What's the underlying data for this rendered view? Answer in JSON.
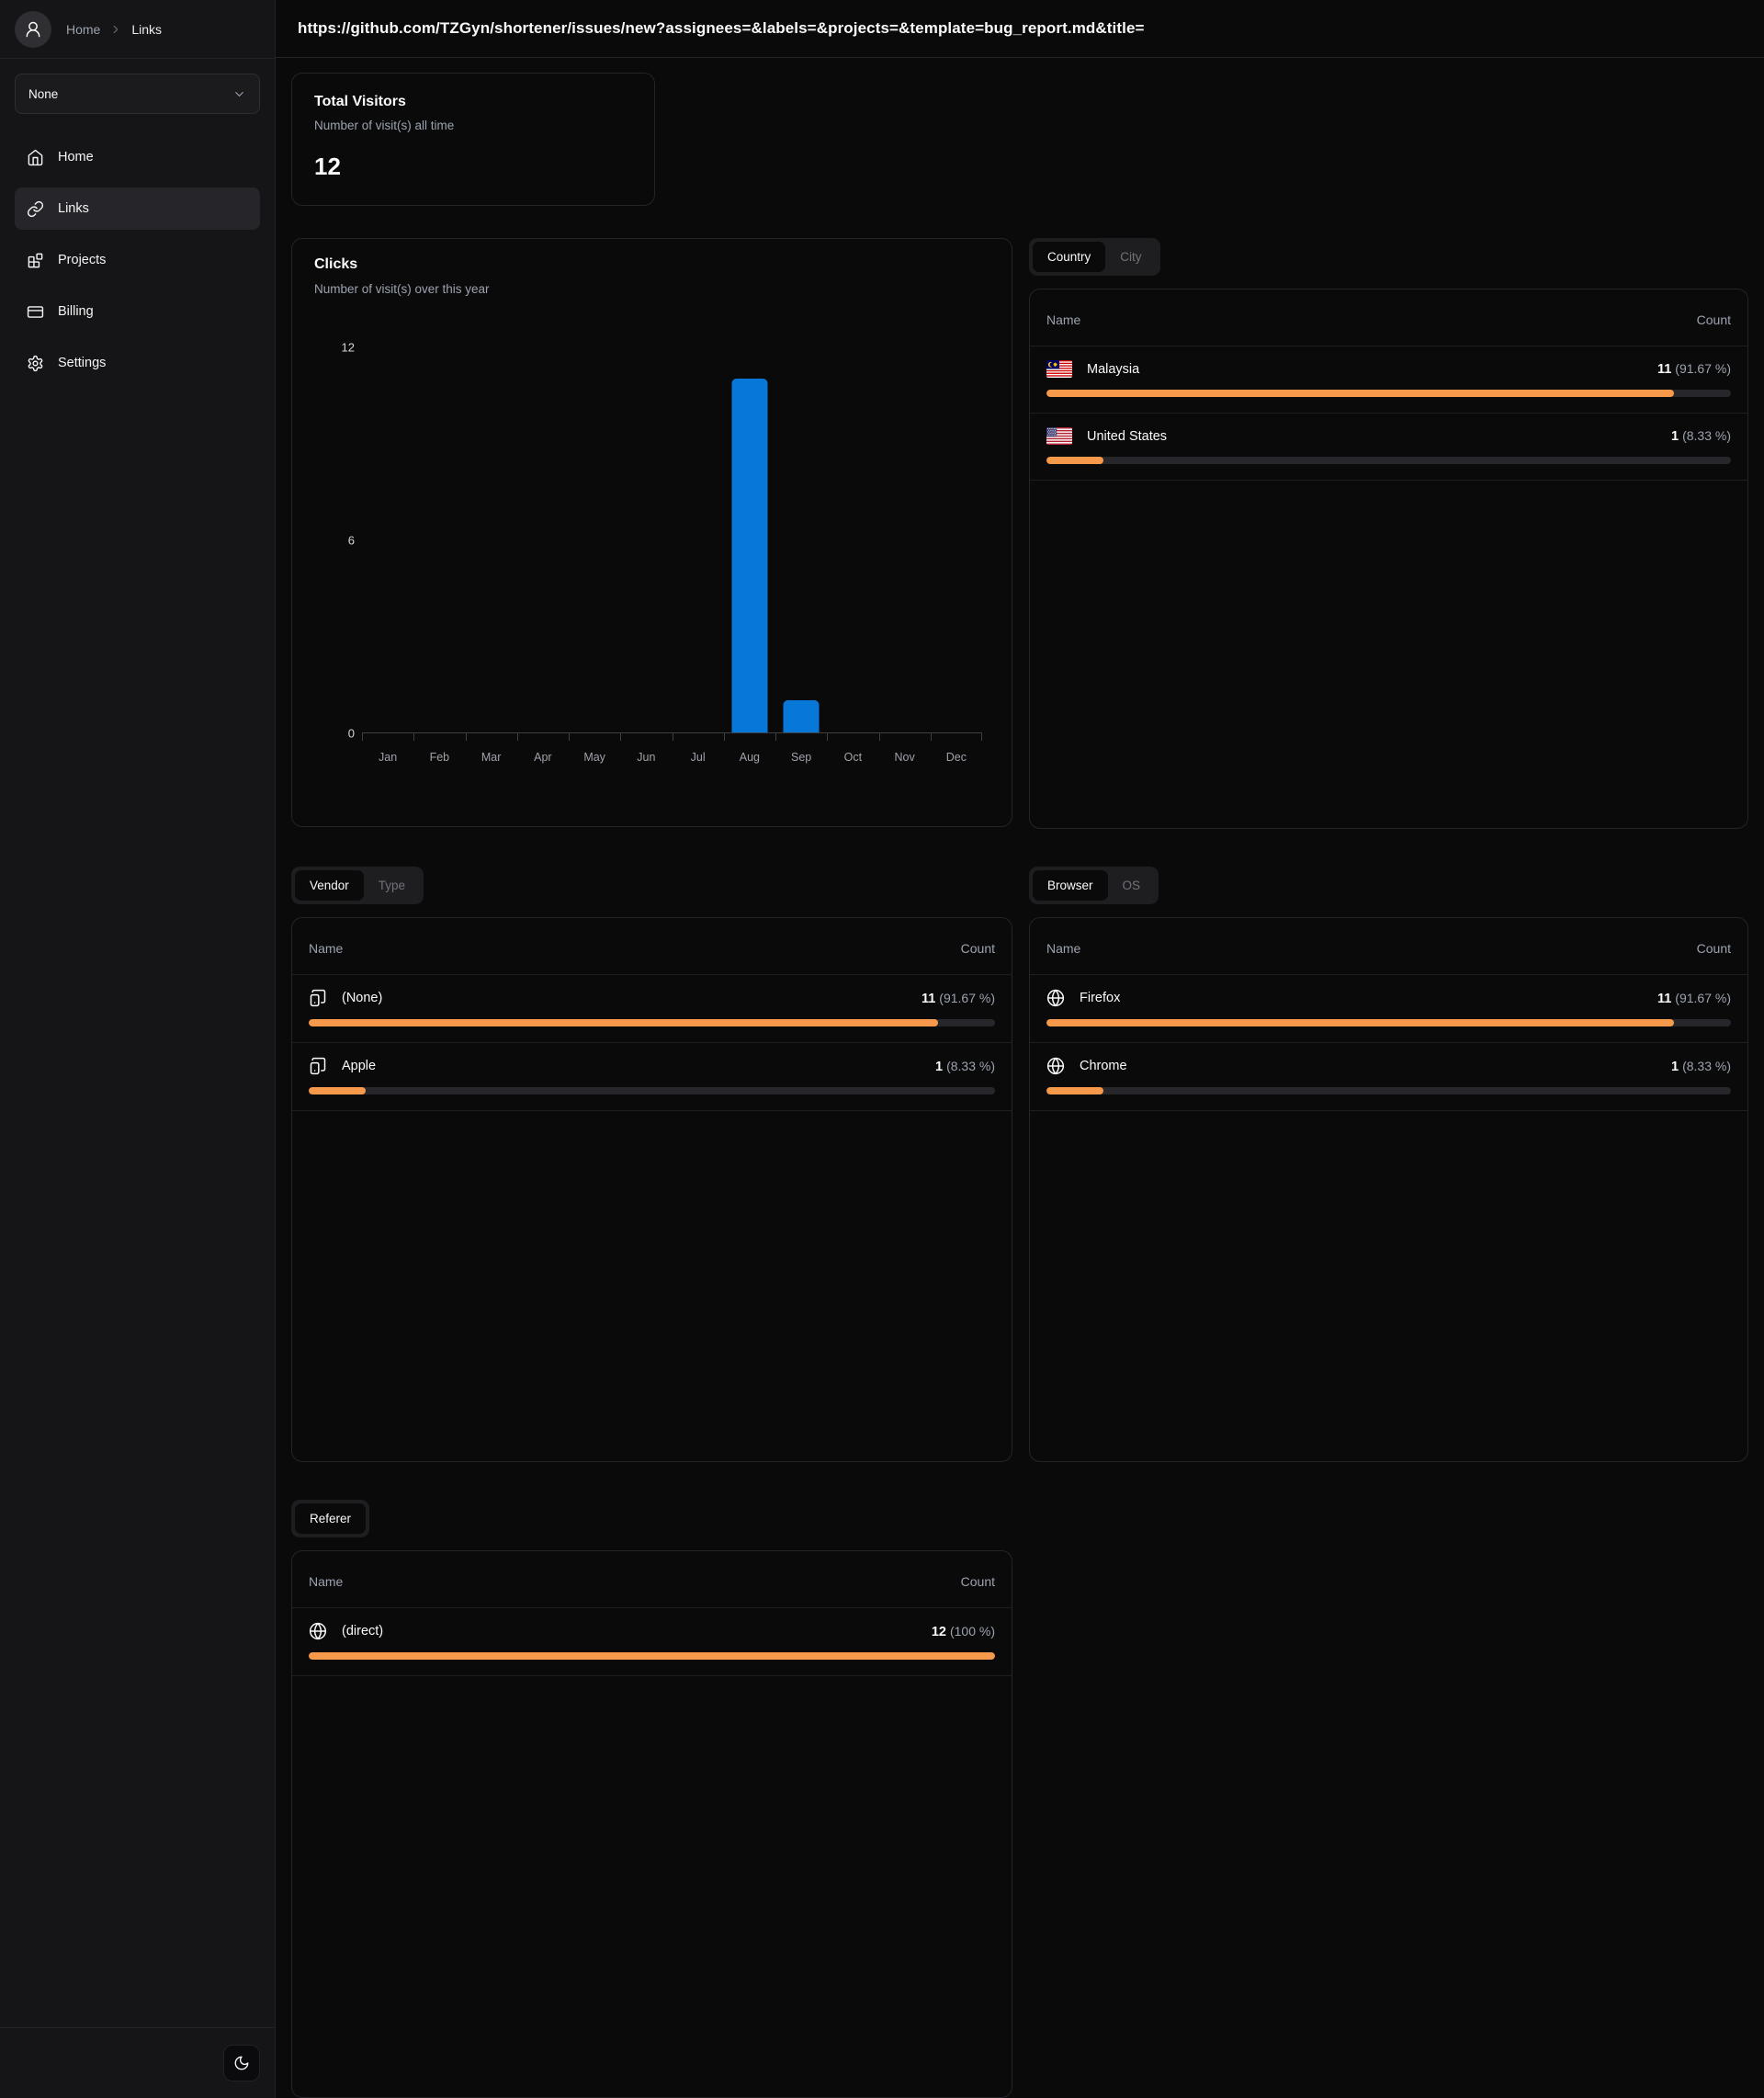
{
  "header": {
    "url_title": "https://github.com/TZGyn/shortener/issues/new?assignees=&labels=&projects=&template=bug_report.md&title="
  },
  "sidebar": {
    "breadcrumb": {
      "home": "Home",
      "separator_icon": "chevron-right-icon",
      "current": "Links"
    },
    "avatar_icon": "user-icon",
    "project_select": {
      "value": "None",
      "icon": "chevron-down-icon"
    },
    "items": [
      {
        "label": "Home",
        "icon": "house-icon",
        "active": false
      },
      {
        "label": "Links",
        "icon": "link-icon",
        "active": true
      },
      {
        "label": "Projects",
        "icon": "blocks-icon",
        "active": false
      },
      {
        "label": "Billing",
        "icon": "credit-card-icon",
        "active": false
      },
      {
        "label": "Settings",
        "icon": "gear-icon",
        "active": false
      }
    ],
    "theme_toggle_icon": "moon-icon"
  },
  "total_visitors": {
    "title": "Total Visitors",
    "subtitle": "Number of visit(s) all time",
    "value": "12"
  },
  "chart_data": {
    "type": "bar",
    "title": "Clicks",
    "subtitle": "Number of visit(s) over this year",
    "categories": [
      "Jan",
      "Feb",
      "Mar",
      "Apr",
      "May",
      "Jun",
      "Jul",
      "Aug",
      "Sep",
      "Oct",
      "Nov",
      "Dec"
    ],
    "values": [
      0,
      0,
      0,
      0,
      0,
      0,
      0,
      11,
      1,
      0,
      0,
      0
    ],
    "ylim": [
      0,
      12
    ],
    "yticks": [
      12,
      6,
      0
    ],
    "xlabel": "",
    "ylabel": "",
    "grid": false,
    "legend": false,
    "bar_color": "#0878d8"
  },
  "colors": {
    "accent_orange": "#f7994a",
    "bar_blue": "#0878d8"
  },
  "sections": {
    "country": {
      "tabs": [
        {
          "label": "Country"
        },
        {
          "label": "City"
        }
      ],
      "columns": {
        "name": "Name",
        "count": "Count"
      },
      "rows": [
        {
          "icon": "malaysia-flag-icon",
          "name": "Malaysia",
          "count": "11",
          "pct": "(91.67 %)",
          "pct_value": 91.67
        },
        {
          "icon": "us-flag-icon",
          "name": "United States",
          "count": "1",
          "pct": "(8.33 %)",
          "pct_value": 8.33
        }
      ]
    },
    "vendor": {
      "tabs": [
        {
          "label": "Vendor"
        },
        {
          "label": "Type"
        }
      ],
      "columns": {
        "name": "Name",
        "count": "Count"
      },
      "rows": [
        {
          "icon": "smartphone-icon",
          "name": "(None)",
          "count": "11",
          "pct": "(91.67 %)",
          "pct_value": 91.67
        },
        {
          "icon": "smartphone-icon",
          "name": "Apple",
          "count": "1",
          "pct": "(8.33 %)",
          "pct_value": 8.33
        }
      ]
    },
    "browser": {
      "tabs": [
        {
          "label": "Browser"
        },
        {
          "label": "OS"
        }
      ],
      "columns": {
        "name": "Name",
        "count": "Count"
      },
      "rows": [
        {
          "icon": "globe-icon",
          "name": "Firefox",
          "count": "11",
          "pct": "(91.67 %)",
          "pct_value": 91.67
        },
        {
          "icon": "globe-icon",
          "name": "Chrome",
          "count": "1",
          "pct": "(8.33 %)",
          "pct_value": 8.33
        }
      ]
    },
    "referer": {
      "tabs": [
        {
          "label": "Referer"
        }
      ],
      "columns": {
        "name": "Name",
        "count": "Count"
      },
      "rows": [
        {
          "icon": "globe-icon",
          "name": "(direct)",
          "count": "12",
          "pct": "(100 %)",
          "pct_value": 100
        }
      ]
    }
  }
}
